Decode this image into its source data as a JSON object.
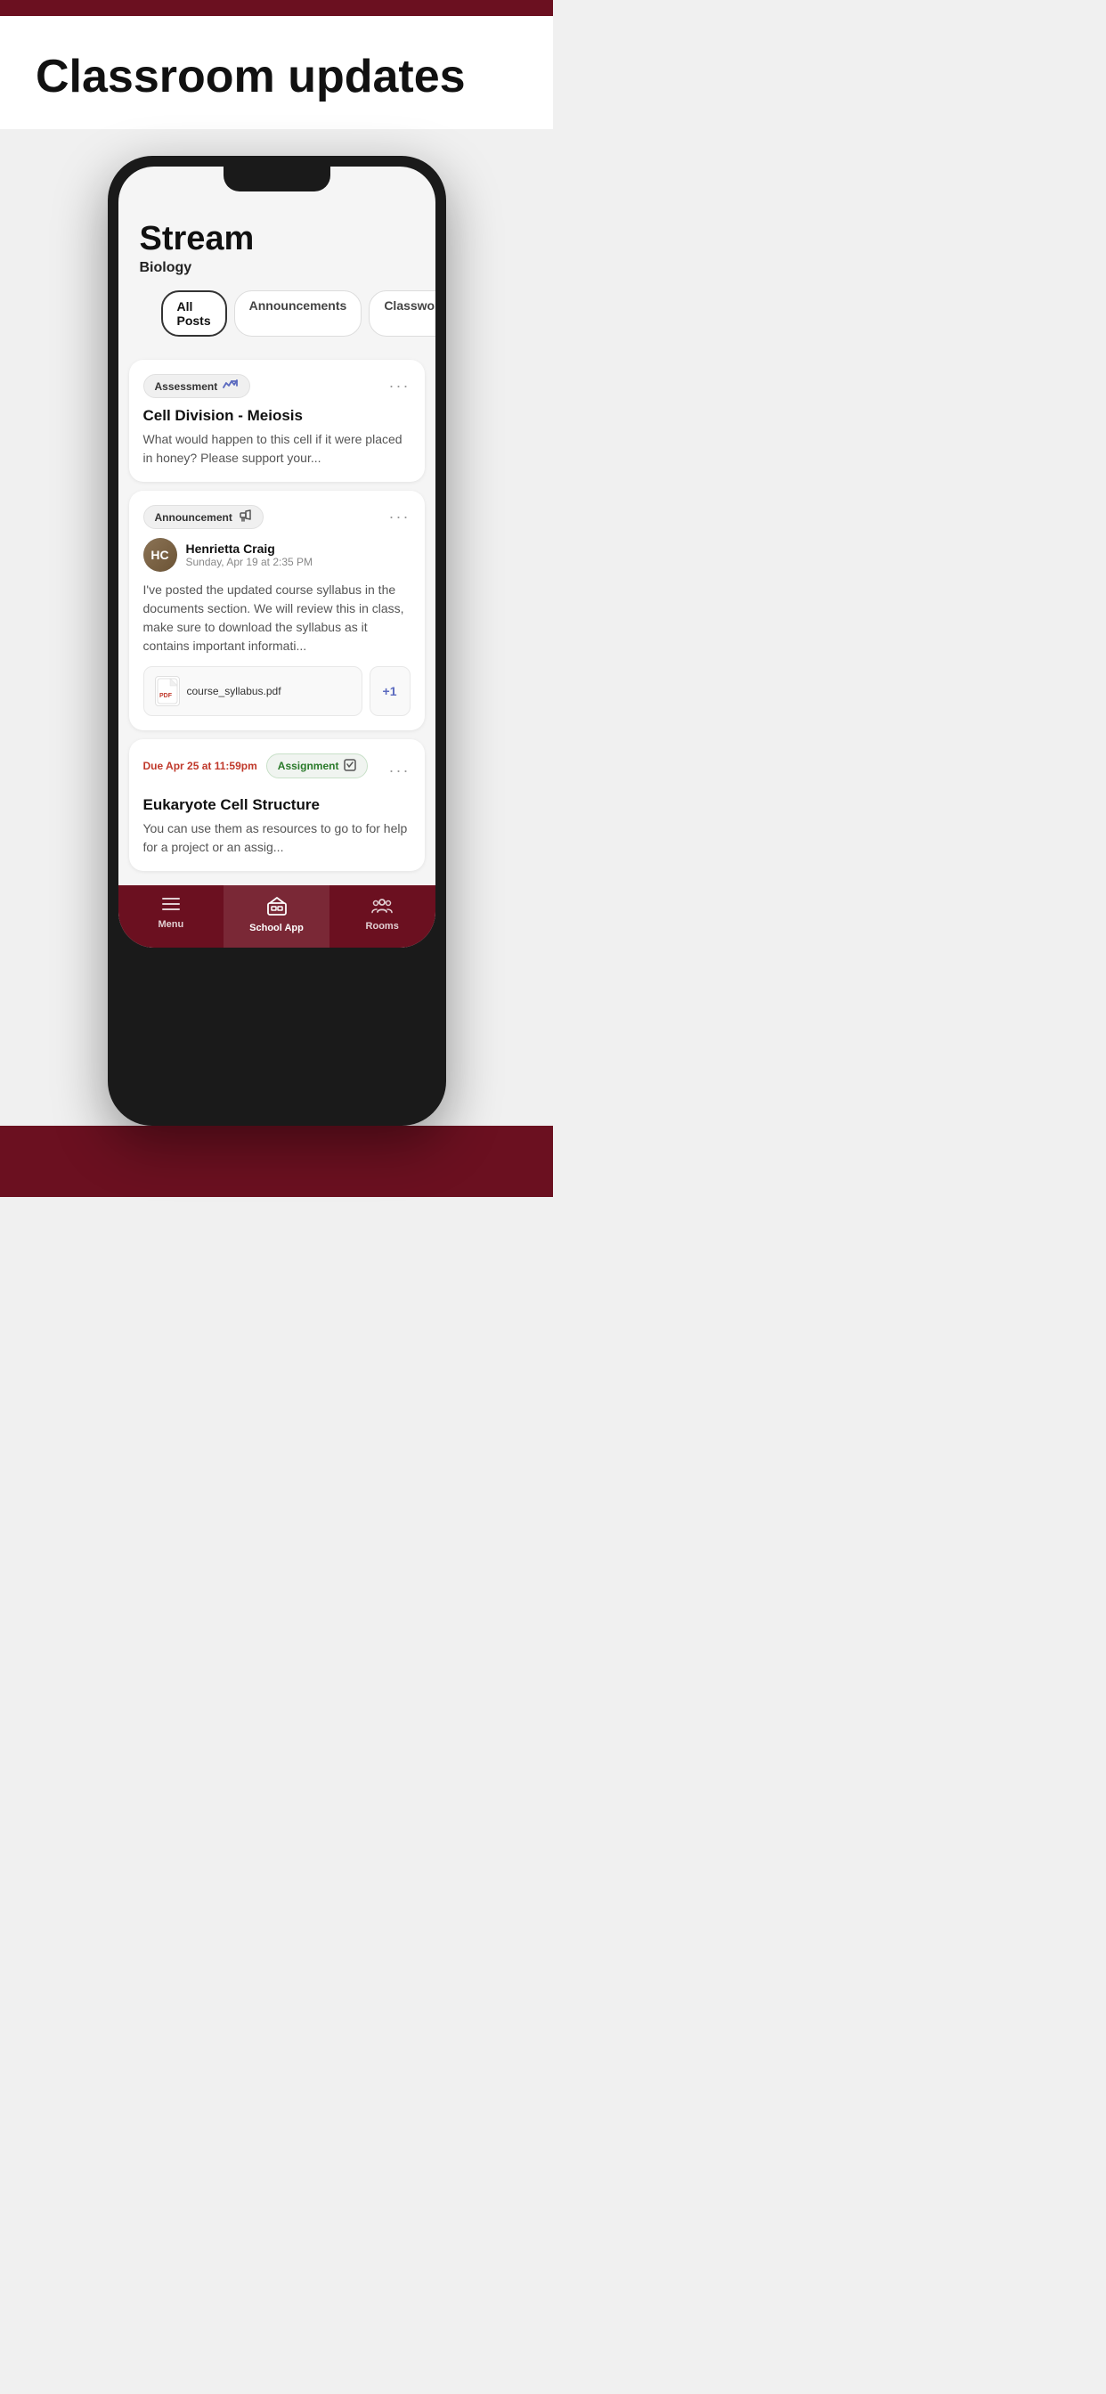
{
  "page": {
    "top_bar_color": "#6b1020",
    "background": "#f0f0f0",
    "heading": "Classroom updates"
  },
  "phone": {
    "screen": {
      "stream_title": "Stream",
      "stream_subtitle": "Biology",
      "tabs": [
        {
          "label": "All Posts",
          "active": true
        },
        {
          "label": "Announcements",
          "active": false
        },
        {
          "label": "Classwork",
          "active": false
        }
      ],
      "cards": [
        {
          "type": "assessment",
          "tag": "Assessment",
          "title": "Cell Division - Meiosis",
          "body": "What would happen to this cell if it were placed in honey? Please support your..."
        },
        {
          "type": "announcement",
          "tag": "Announcement",
          "author_name": "Henrietta Craig",
          "author_date": "Sunday, Apr 19 at 2:35 PM",
          "body": "I've posted the updated course syllabus in the documents section. We will review this in class, make sure to download the syllabus as it contains important informati...",
          "attachment": "course_syllabus.pdf",
          "plus_count": "+1"
        },
        {
          "type": "assignment",
          "due": "Due Apr 25 at 11:59pm",
          "tag": "Assignment",
          "title": "Eukaryote Cell Structure",
          "body": "You can use them as resources to go to for help for a project or an assig..."
        }
      ]
    },
    "nav": [
      {
        "label": "Menu",
        "icon": "menu",
        "active": false
      },
      {
        "label": "School App",
        "icon": "school",
        "active": true
      },
      {
        "label": "Rooms",
        "icon": "rooms",
        "active": false
      }
    ]
  }
}
